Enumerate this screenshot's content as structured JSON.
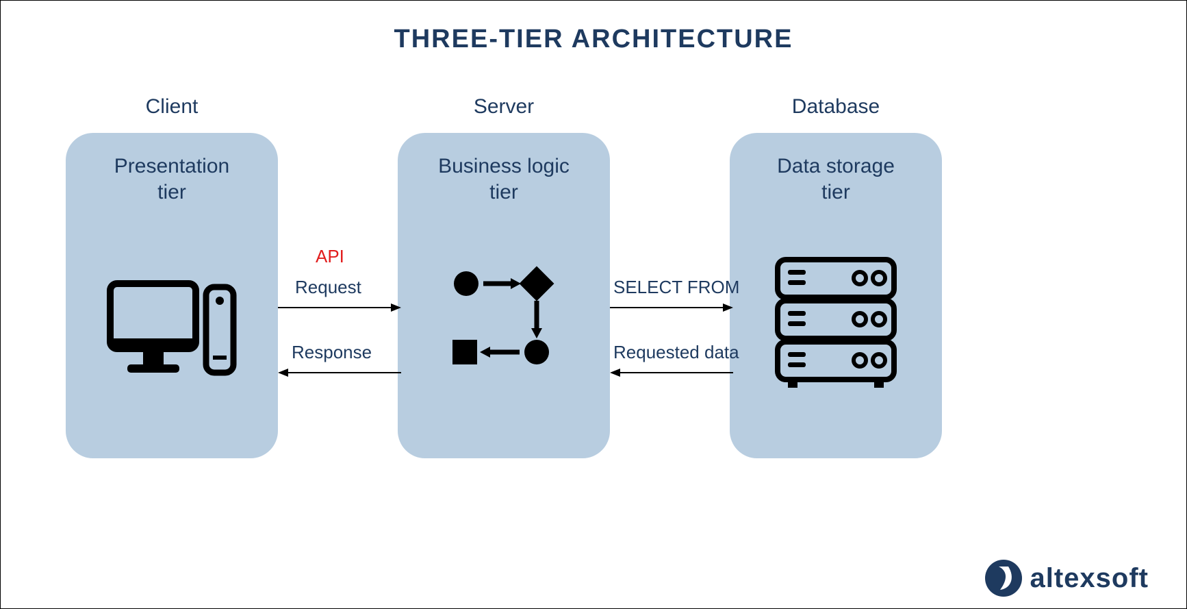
{
  "title": "THREE-TIER ARCHITECTURE",
  "tiers": {
    "client": {
      "outer_label": "Client",
      "inner_label": "Presentation\ntier"
    },
    "server": {
      "outer_label": "Server",
      "inner_label": "Business logic\ntier"
    },
    "database": {
      "outer_label": "Database",
      "inner_label": "Data storage\ntier"
    }
  },
  "api_label": "API",
  "arrows": {
    "client_to_server": "Request",
    "server_to_client": "Response",
    "server_to_db": "SELECT FROM",
    "db_to_server": "Requested data"
  },
  "logo_text": "altexsoft",
  "colors": {
    "brand_dark": "#1e3a5f",
    "box_fill": "#b8cde0",
    "api_red": "#e11d1d"
  }
}
